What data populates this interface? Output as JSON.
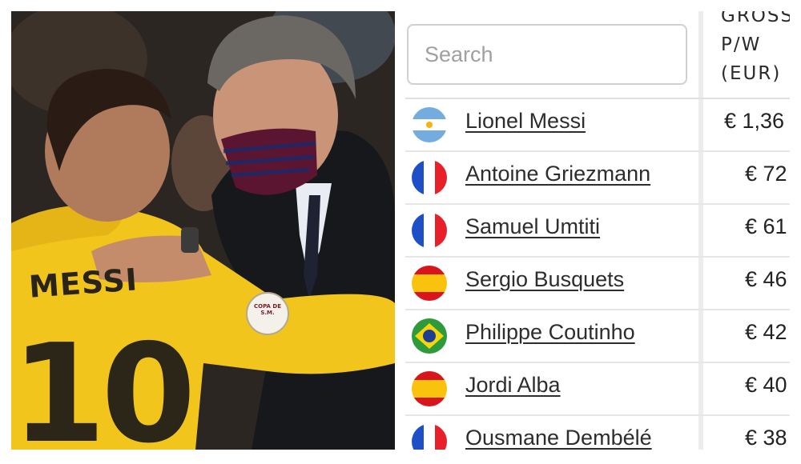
{
  "photo": {
    "shirt_name": "MESSI",
    "shirt_number": "10",
    "badge_text": "COPA DE S.M."
  },
  "search": {
    "placeholder": "Search"
  },
  "column_header": {
    "line1": "GROSS",
    "line2": "P/W",
    "line3": "(EUR)"
  },
  "players": [
    {
      "name": "Lionel Messi",
      "flag": "argentina-flag-icon",
      "salary": "€ 1,36"
    },
    {
      "name": "Antoine Griezmann",
      "flag": "france-flag-icon",
      "salary": "€ 72"
    },
    {
      "name": "Samuel Umtiti",
      "flag": "france-flag-icon",
      "salary": "€ 61"
    },
    {
      "name": "Sergio Busquets",
      "flag": "spain-flag-icon",
      "salary": "€ 46"
    },
    {
      "name": "Philippe Coutinho",
      "flag": "brazil-flag-icon",
      "salary": "€ 42"
    },
    {
      "name": "Jordi Alba",
      "flag": "spain-flag-icon",
      "salary": "€ 40"
    },
    {
      "name": "Ousmane Dembélé",
      "flag": "france-flag-icon",
      "salary": "€ 38"
    }
  ],
  "colors": {
    "argentina_blue": "#74acdf",
    "france_blue": "#1f4fc6",
    "france_red": "#e8202a",
    "spain_red": "#d8151d",
    "spain_yellow": "#f9c20d",
    "brazil_green": "#2f9a3c",
    "brazil_yellow": "#f5d60c",
    "brazil_blue": "#1e3f8f"
  }
}
